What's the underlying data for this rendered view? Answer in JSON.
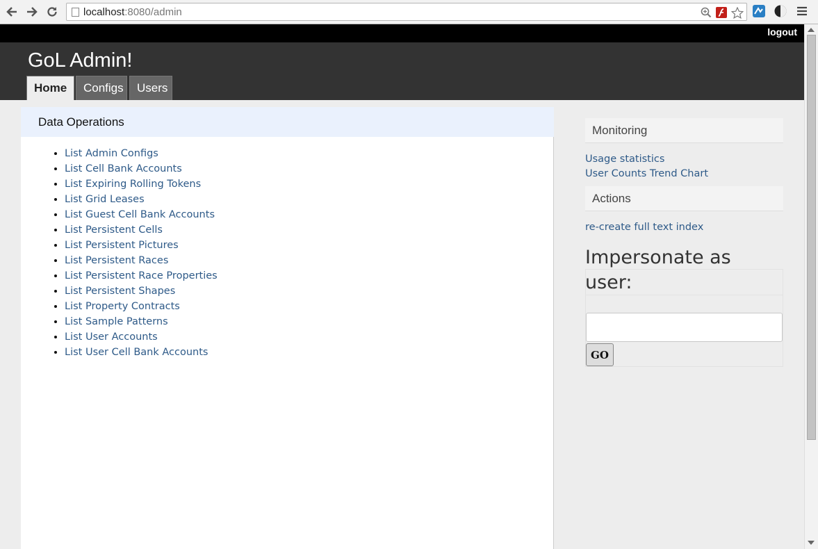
{
  "browser": {
    "url_host": "localhost",
    "url_path": ":8080/admin"
  },
  "topbar": {
    "logout_label": "logout"
  },
  "header": {
    "title": "GoL Admin!",
    "tabs": [
      {
        "label": "Home",
        "active": true
      },
      {
        "label": "Configs",
        "active": false
      },
      {
        "label": "Users",
        "active": false
      }
    ]
  },
  "main": {
    "heading": "Data Operations",
    "links": [
      "List Admin Configs",
      "List Cell Bank Accounts",
      "List Expiring Rolling Tokens",
      "List Grid Leases",
      "List Guest Cell Bank Accounts",
      "List Persistent Cells",
      "List Persistent Pictures",
      "List Persistent Races",
      "List Persistent Race Properties",
      "List Persistent Shapes",
      "List Property Contracts",
      "List Sample Patterns",
      "List User Accounts",
      "List User Cell Bank Accounts"
    ]
  },
  "sidebar": {
    "monitoring_heading": "Monitoring",
    "monitoring_links": [
      "Usage statistics",
      "User Counts Trend Chart"
    ],
    "actions_heading": "Actions",
    "actions_links": [
      "re-create full text index"
    ],
    "impersonate_title_line1": "Impersonate as",
    "impersonate_title_line2": "user:",
    "impersonate_input_value": "",
    "go_label": "GO"
  }
}
